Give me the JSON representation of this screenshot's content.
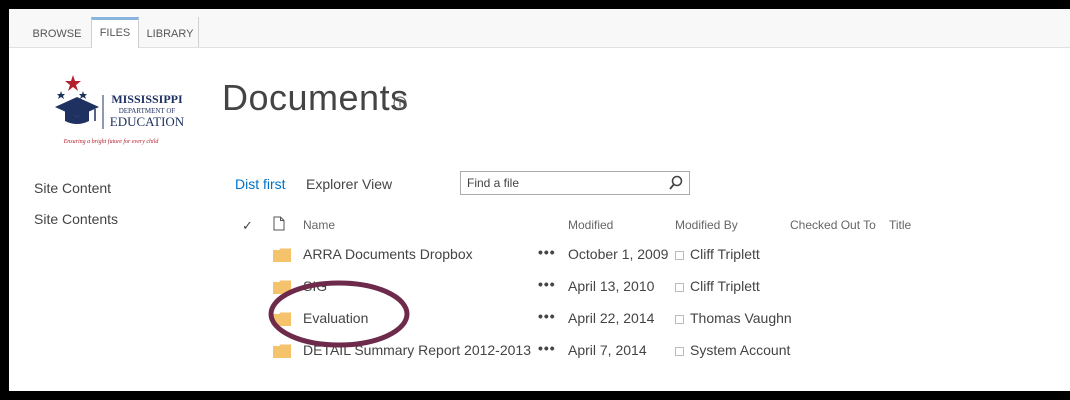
{
  "ribbon": {
    "tabs": [
      {
        "label": "BROWSE",
        "active": false
      },
      {
        "label": "FILES",
        "active": true
      },
      {
        "label": "LIBRARY",
        "active": false
      }
    ]
  },
  "logo": {
    "line1": "MISSISSIPPI",
    "line2": "DEPARTMENT OF",
    "line3": "EDUCATION",
    "tagline": "Ensuring a bright future for every child",
    "colors": {
      "navy": "#1f3160",
      "red": "#b5202e"
    }
  },
  "page": {
    "title": "Documents"
  },
  "left_nav": {
    "items": [
      "Site Content",
      "Site Contents"
    ]
  },
  "views": {
    "current": "Dist first",
    "other": "Explorer View"
  },
  "search": {
    "placeholder": "Find a file"
  },
  "list": {
    "columns": {
      "check": "✓",
      "name": "Name",
      "modified": "Modified",
      "modified_by": "Modified By",
      "checked_out_to": "Checked Out To",
      "title": "Title"
    },
    "rows": [
      {
        "name": "ARRA Documents Dropbox",
        "modified": "October 1, 2009",
        "modified_by": "Cliff Triplett"
      },
      {
        "name": "SIG",
        "modified": "April 13, 2010",
        "modified_by": "Cliff Triplett"
      },
      {
        "name": "Evaluation",
        "modified": "April 22, 2014",
        "modified_by": "Thomas Vaughn"
      },
      {
        "name": "DETAIL Summary Report 2012-2013",
        "modified": "April 7, 2014",
        "modified_by": "System Account"
      }
    ],
    "ellipsis": "•••"
  },
  "colors": {
    "link": "#0072c6",
    "folder": "#f5c36b",
    "annotation": "#6e2a4a"
  }
}
